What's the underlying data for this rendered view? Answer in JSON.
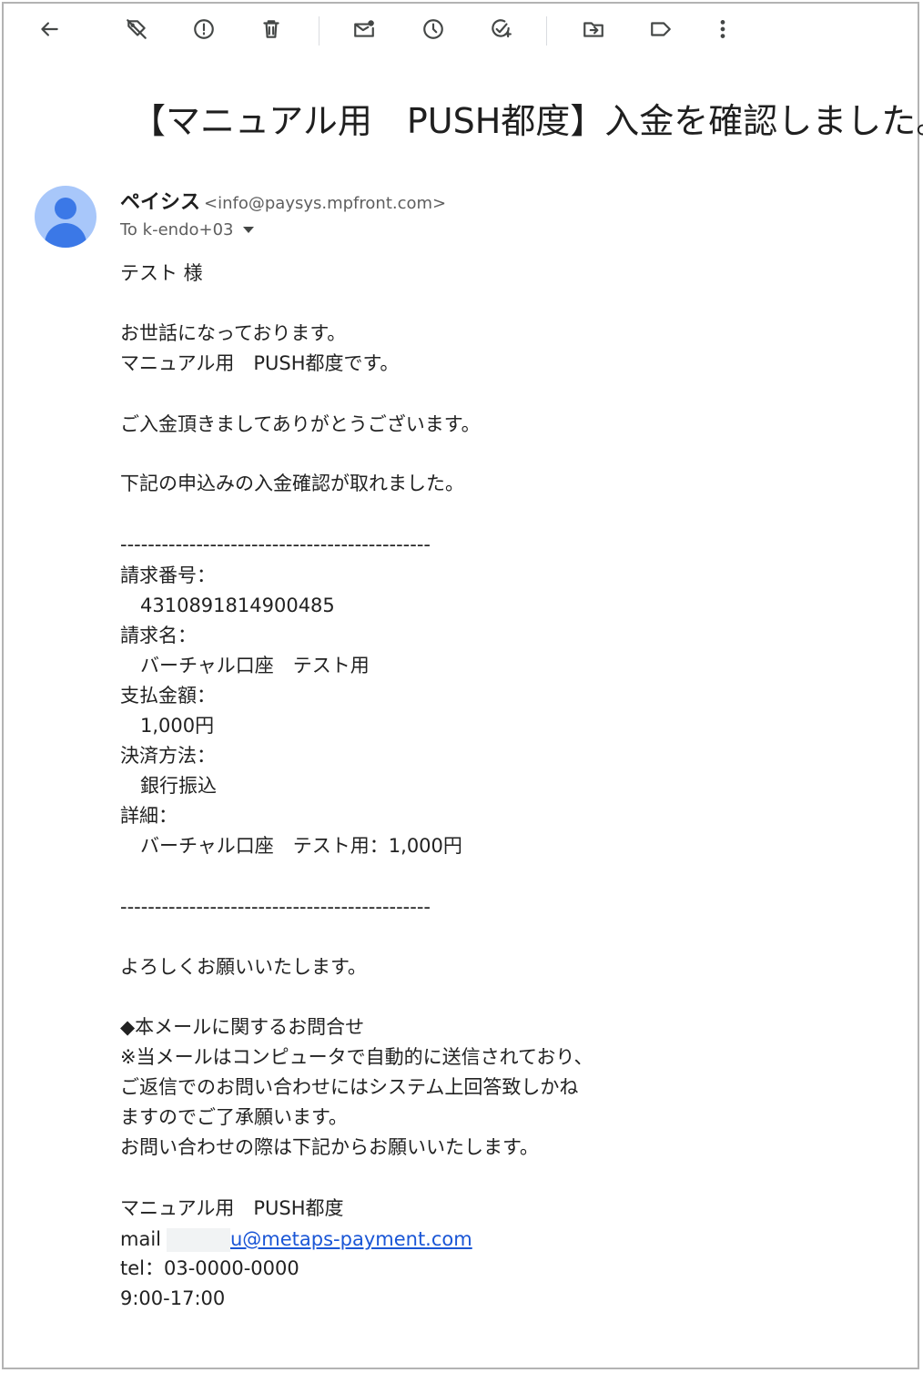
{
  "toolbar": {
    "icons": [
      "back-arrow-icon",
      "tag-off-icon",
      "report-spam-icon",
      "delete-icon",
      "mark-unread-icon",
      "snooze-icon",
      "add-task-icon",
      "move-to-icon",
      "label-icon",
      "more-vert-icon"
    ]
  },
  "email": {
    "subject": "【マニュアル用　PUSH都度】入金を確認しました。",
    "sender_name": "ペイシス",
    "sender_email": "<info@paysys.mpfront.com>",
    "recipient": "To k-endo+03",
    "avatar_color": "#a8c7fa",
    "body": {
      "greeting": "テスト 様",
      "p1_l1": "お世話になっております。",
      "p1_l2": "マニュアル用　PUSH都度です。",
      "p2": "ご入金頂きましてありがとうございます。",
      "p3": "下記の申込みの入金確認が取れました。",
      "divider": "---------------------------------------------",
      "invoice_no_label": "請求番号：",
      "invoice_no": "4310891814900485",
      "invoice_name_label": "請求名：",
      "invoice_name": "バーチャル口座　テスト用",
      "amount_label": "支払金額：",
      "amount": "1,000円",
      "method_label": "決済方法：",
      "method": "銀行振込",
      "detail_label": "詳細：",
      "detail": "バーチャル口座　テスト用：1,000円",
      "closing": "よろしくお願いいたします。",
      "inq_title": "◆本メールに関するお問合せ",
      "inq_l1": "※当メールはコンピュータで自動的に送信されており、",
      "inq_l2": "ご返信でのお問い合わせにはシステム上回答致しかね",
      "inq_l3": "ますのでご了承願います。",
      "inq_l4": "お問い合わせの際は下記からお願いいたします。",
      "sig_name": "マニュアル用　PUSH都度",
      "mail_label": "mail",
      "mail_link": "u@metaps-payment.com",
      "tel": "tel：03-0000-0000",
      "hours": "9:00-17:00"
    }
  }
}
